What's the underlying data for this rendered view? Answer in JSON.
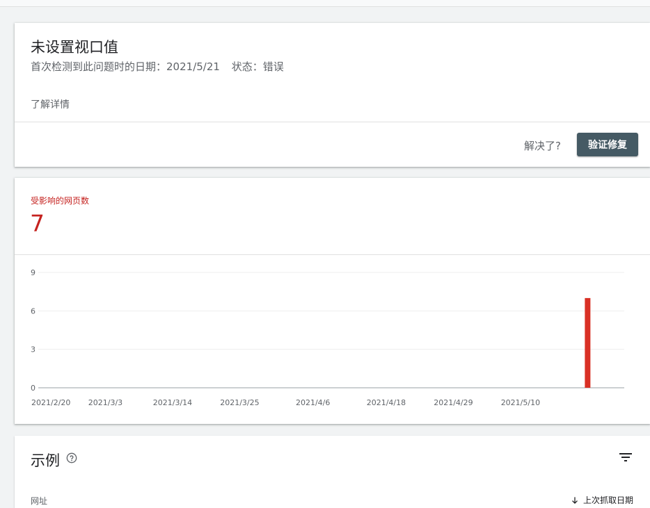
{
  "issue": {
    "title": "未设置视口值",
    "first_detected_label": "首次检测到此问题时的日期：",
    "first_detected_date": "2021/5/21",
    "status_label": "状态：",
    "status_value": "错误",
    "learn_more": "了解详情",
    "resolved_question": "解决了?",
    "validate_button": "验证修复"
  },
  "metric": {
    "label": "受影响的网页数",
    "value": "7",
    "color": "#c5221f"
  },
  "chart_data": {
    "type": "bar",
    "x_tick_labels": [
      "2021/2/20",
      "2021/3/3",
      "2021/3/14",
      "2021/3/25",
      "2021/4/6",
      "2021/4/18",
      "2021/4/29",
      "2021/5/10"
    ],
    "y_ticks": [
      0,
      3,
      6,
      9
    ],
    "ylim": [
      0,
      9
    ],
    "xlim": [
      "2021/2/20",
      "2021/5/27"
    ],
    "grid": true,
    "bar_color": "#d93025",
    "series": [
      {
        "points": [
          {
            "date": "2021/5/21",
            "value": 7
          }
        ]
      }
    ]
  },
  "examples": {
    "title": "示例",
    "col_url": "网址",
    "col_last_crawled": "上次抓取日期",
    "help_icon": "help-circle-icon",
    "filter_icon": "filter-icon",
    "sort_icon": "arrow-down-icon"
  }
}
